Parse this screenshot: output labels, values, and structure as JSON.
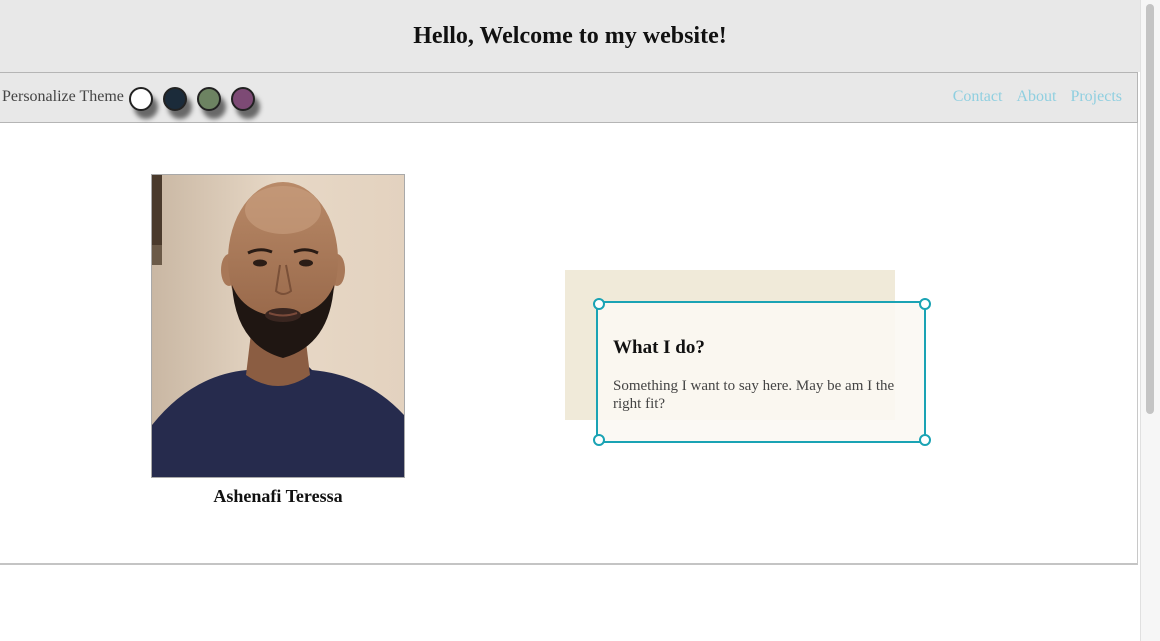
{
  "header": {
    "title": "Hello, Welcome to my website!"
  },
  "navbar": {
    "theme_label": "Personalize Theme",
    "swatches": [
      {
        "name": "white",
        "color": "#ffffff"
      },
      {
        "name": "navy",
        "color": "#1b2b3a"
      },
      {
        "name": "sage",
        "color": "#6d8362"
      },
      {
        "name": "plum",
        "color": "#7d4a75"
      }
    ],
    "links": [
      "Contact",
      "About",
      "Projects"
    ]
  },
  "profile": {
    "name": "Ashenafi Teressa",
    "photo": "portrait-photo"
  },
  "card": {
    "heading": "What I do?",
    "text": "Something I want to say here. May be am I the right fit?"
  },
  "colors": {
    "accent": "#1aa3b4",
    "link": "#8fcfe0",
    "header_bg": "#e8e8e8",
    "card_back": "#f0ead9"
  }
}
